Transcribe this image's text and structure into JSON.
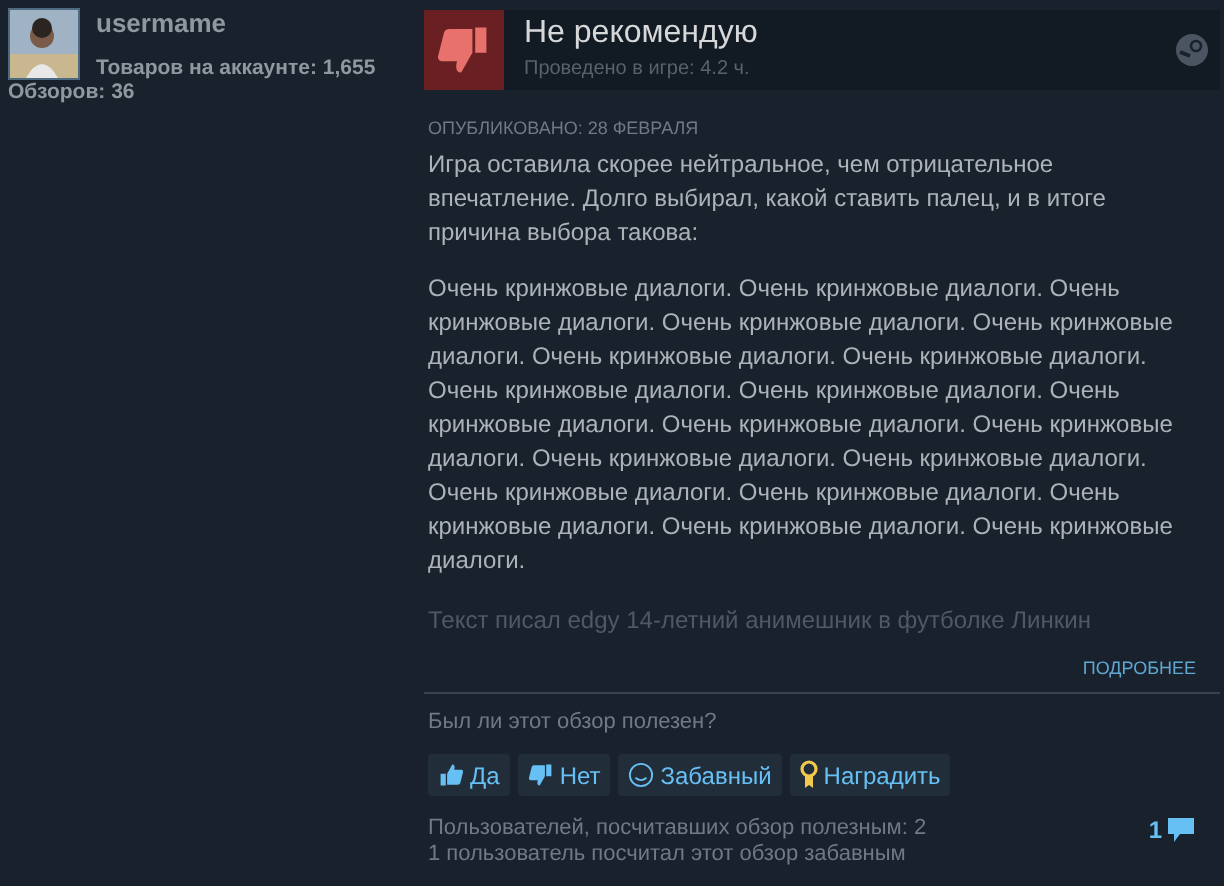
{
  "author": {
    "name": "usermame",
    "products": "Товаров на аккаунте: 1,655",
    "reviews": "Обзоров: 36"
  },
  "review": {
    "verdict": "Не рекомендую",
    "playtime": "Проведено в игре: 4.2 ч.",
    "posted": "ОПУБЛИКОВАНО: 28 ФЕВРАЛЯ",
    "paragraphs": [
      "Игра оставила скорее нейтральное, чем отрицательное впечатление. Долго выбирал, какой ставить палец, и в итоге причина выбора такова:",
      "Очень кринжовые диалоги. Очень кринжовые диалоги. Очень кринжовые диалоги. Очень кринжовые диалоги. Очень кринжовые диалоги. Очень кринжовые диалоги. Очень кринжовые диалоги. Очень кринжовые диалоги. Очень кринжовые диалоги. Очень кринжовые диалоги. Очень кринжовые диалоги. Очень кринжовые диалоги. Очень кринжовые диалоги. Очень кринжовые диалоги. Очень кринжовые диалоги. Очень кринжовые диалоги. Очень кринжовые диалоги. Очень кринжовые диалоги. Очень кринжовые диалоги."
    ],
    "faded": "Текст писал edgy 14-летний анимешник в футболке Линкин",
    "more": "ПОДРОБНЕЕ"
  },
  "helpful": {
    "question": "Был ли этот обзор полезен?",
    "buttons": [
      {
        "kind": "up",
        "label": "Да"
      },
      {
        "kind": "down",
        "label": "Нет"
      },
      {
        "kind": "funny",
        "label": "Забавный"
      },
      {
        "kind": "award",
        "label": "Наградить"
      }
    ],
    "stats": [
      "Пользователей, посчитавших обзор полезным: 2",
      "1 пользователь посчитал этот обзор забавным"
    ],
    "comments": "1"
  }
}
